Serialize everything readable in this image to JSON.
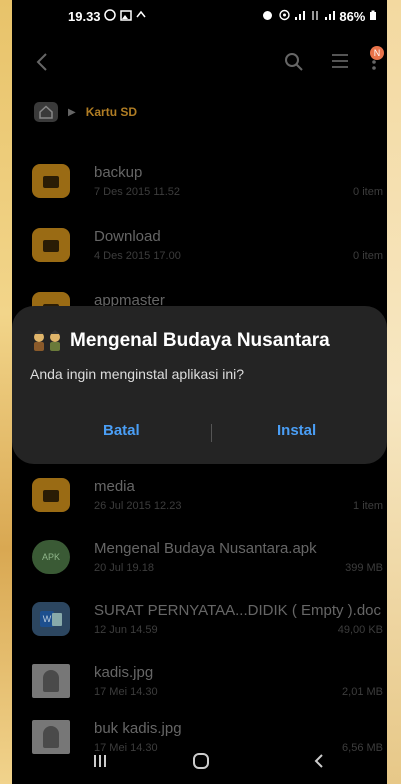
{
  "status_bar": {
    "time": "19.33",
    "left_icons": [
      "whatsapp-icon",
      "gallery-icon",
      "sync-icon"
    ],
    "right_icons": [
      "alarm-icon",
      "hotspot-icon",
      "signal-icon",
      "4g-icon",
      "signal-icon"
    ],
    "battery": "86%"
  },
  "toolbar": {
    "badge": "N",
    "icons": [
      "back-icon",
      "search-icon",
      "list-view-icon",
      "more-icon"
    ]
  },
  "breadcrumb": {
    "location": "Kartu SD"
  },
  "files": [
    {
      "name": "backup",
      "date": "7 Des 2015 11.52",
      "size": "0 item",
      "type": "folder"
    },
    {
      "name": "Download",
      "date": "4 Des 2015 17.00",
      "size": "0 item",
      "type": "folder"
    },
    {
      "name": "appmaster",
      "date": "",
      "size": "",
      "type": "folder"
    },
    {
      "name": "media",
      "date": "26 Jul 2015 12.23",
      "size": "1 item",
      "type": "folder"
    },
    {
      "name": "Mengenal Budaya Nusantara.apk",
      "date": "20 Jul 19.18",
      "size": "399 MB",
      "type": "apk",
      "icon_label": "APK"
    },
    {
      "name": "SURAT PERNYATAA...DIDIK ( Empty ).doc",
      "date": "12 Jun 14.59",
      "size": "49,00 KB",
      "type": "doc"
    },
    {
      "name": "kadis.jpg",
      "date": "17 Mei 14.30",
      "size": "2,01 MB",
      "type": "image"
    },
    {
      "name": "buk kadis.jpg",
      "date": "17 Mei 14.30",
      "size": "6,56 MB",
      "type": "image"
    }
  ],
  "dialog": {
    "title": "Mengenal Budaya Nusantara",
    "message": "Anda ingin menginstal aplikasi ini?",
    "cancel": "Batal",
    "install": "Instal",
    "accent": "#4a9ef5"
  },
  "nav_bar": {
    "icons": [
      "recent-apps-icon",
      "home-icon",
      "back-icon"
    ]
  }
}
